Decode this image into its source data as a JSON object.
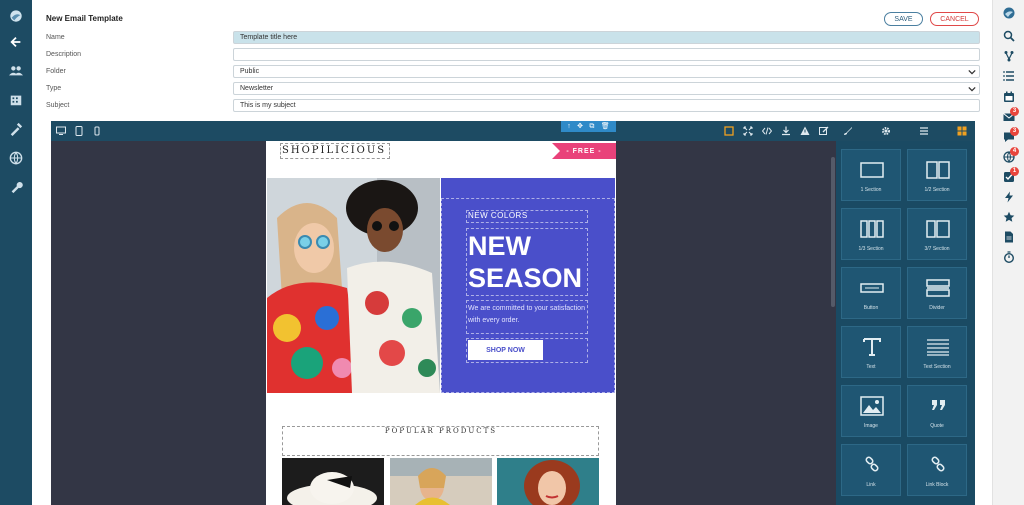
{
  "form": {
    "title": "New Email Template",
    "save_label": "SAVE",
    "cancel_label": "CANCEL",
    "fields": [
      {
        "label": "Name",
        "value": "Template title here"
      },
      {
        "label": "Description",
        "value": ""
      },
      {
        "label": "Folder",
        "value": "Public"
      },
      {
        "label": "Type",
        "value": "Newsletter"
      },
      {
        "label": "Subject",
        "value": "This is my subject"
      }
    ]
  },
  "email": {
    "brand": "SHOPILICIOUS",
    "tag": "- FREE -",
    "hero_small": "NEW COLORS",
    "hero_line1": "NEW",
    "hero_line2": "SEASON",
    "hero_text": "We are committed to your satisfaction with every order.",
    "hero_button": "SHOP NOW",
    "section_title": "POPULAR PRODUCTS"
  },
  "blocks": [
    "1 Section",
    "1/2 Section",
    "1/3 Section",
    "3/7 Section",
    "Button",
    "Divider",
    "Text",
    "Text Section",
    "Image",
    "Quote",
    "Link",
    "Link Block"
  ],
  "badges": {
    "mail": "3",
    "chat": "3",
    "globe": "4",
    "tasks": "1"
  },
  "colors": {
    "sidebar": "#1d4b63",
    "hero_panel": "#4a4fca",
    "free_tag": "#e9427a",
    "cancel": "#e04848"
  }
}
